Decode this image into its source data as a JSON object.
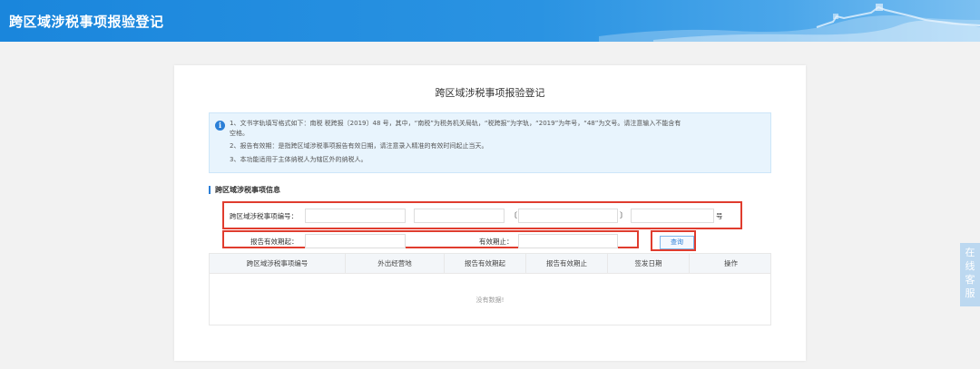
{
  "header": {
    "title": "跨区域涉税事项报验登记"
  },
  "panel": {
    "title": "跨区域涉税事项报验登记"
  },
  "notice": {
    "lines": [
      "1、文书字轨填写格式如下：南税 税跨报〔2019〕48 号，其中，“南税”为税务机关局轨，“税跨报”为字轨，“2019”为年号，“48”为文号。请注意输入不能含有",
      "空格。",
      "2、报告有效期：是指跨区域涉税事项报告有效日期，请注意录入精准的有效时间起止当天。",
      "3、本功能适用于主体纳税人为辖区外的纳税人。"
    ]
  },
  "section": {
    "title": "跨区域涉税事项信息"
  },
  "form": {
    "code_label": "跨区域涉税事项编号：",
    "bracket_open": "〔",
    "bracket_close": "〕",
    "hao": "号",
    "start_label": "报告有效期起：",
    "end_label": "有效期止：",
    "fields": {
      "code1": "",
      "code2": "",
      "code3": "",
      "code4": "",
      "start": "",
      "end": ""
    }
  },
  "query_button": "查询",
  "table": {
    "headers": [
      "跨区域涉税事项编号",
      "外出经营地",
      "报告有效期起",
      "报告有效期止",
      "签发日期",
      "操作"
    ],
    "empty": "没有数据!"
  },
  "service": {
    "chars": [
      "在",
      "线",
      "客",
      "服"
    ]
  },
  "colors": {
    "header": "#1a86dc",
    "highlight": "#e03c2e",
    "accent": "#2b7fd7"
  }
}
